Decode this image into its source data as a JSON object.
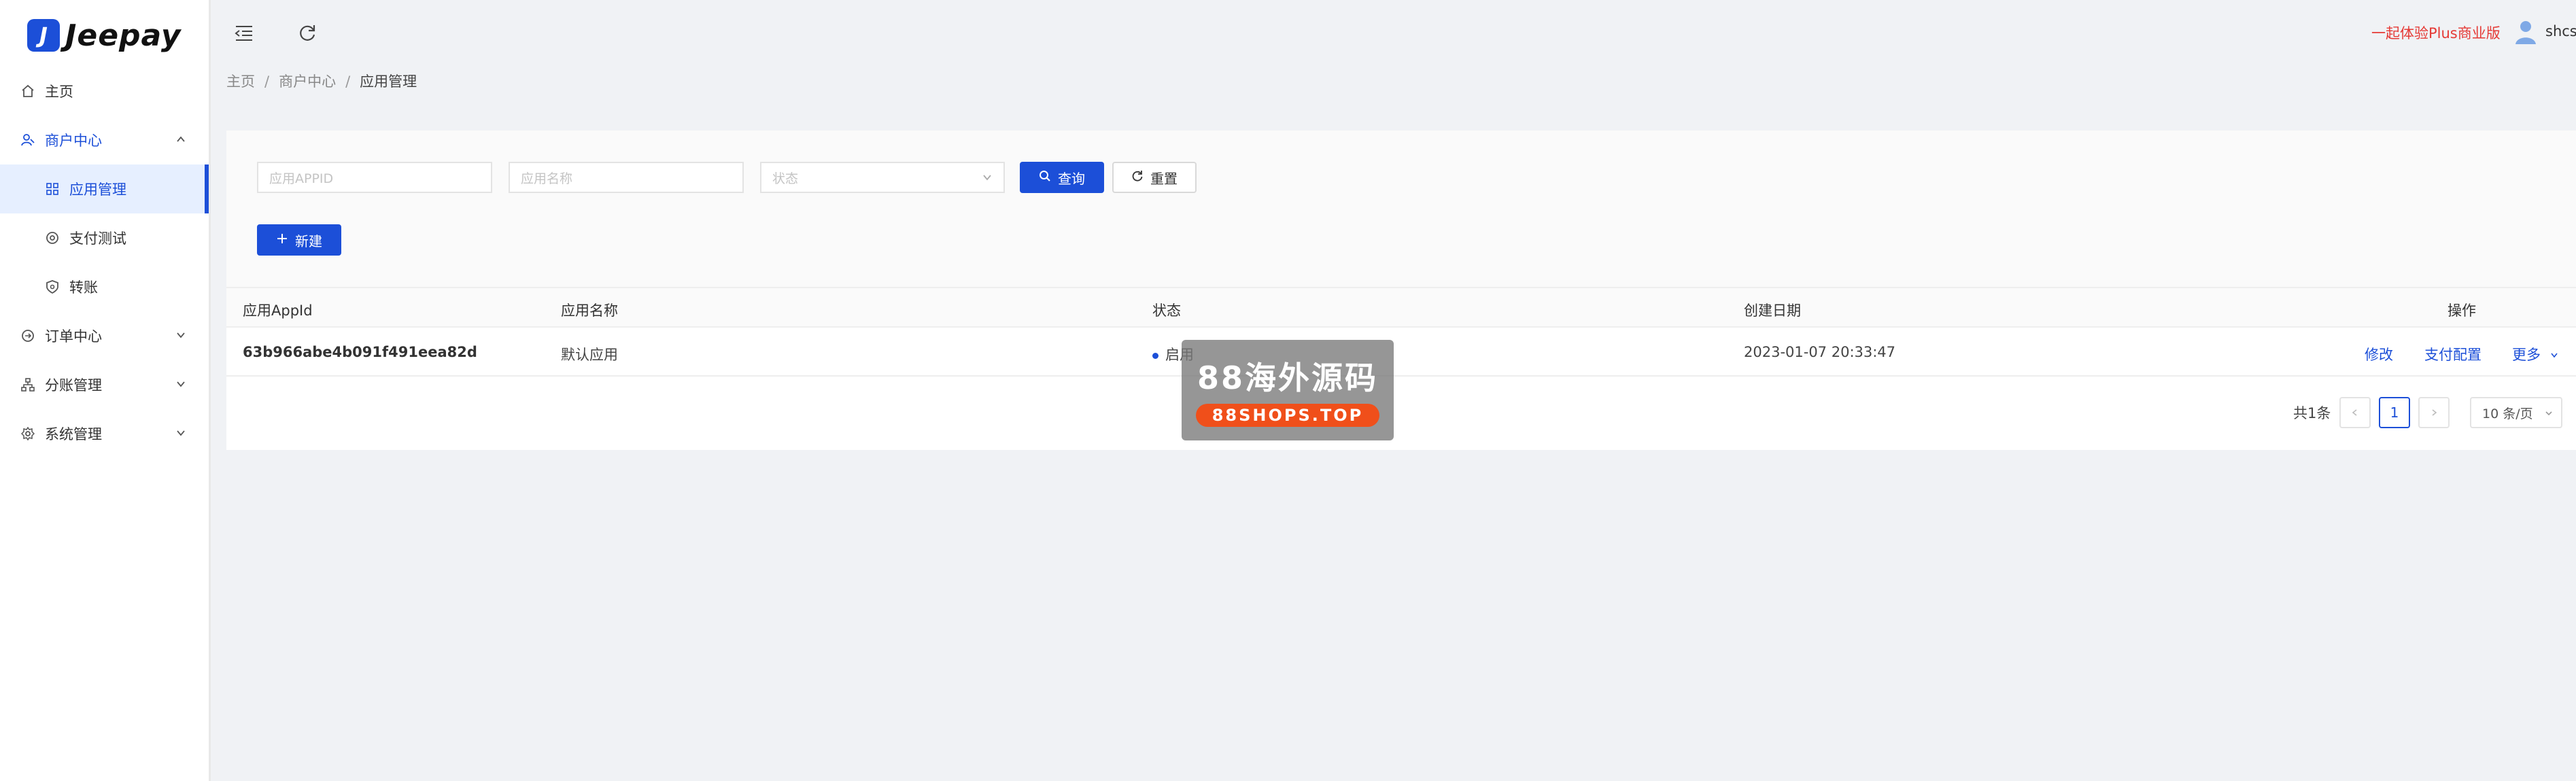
{
  "app": {
    "name": "Jeepay",
    "logo_mark": "J"
  },
  "sidebar": {
    "items": [
      {
        "label": "主页",
        "icon": "home-icon"
      },
      {
        "label": "商户中心",
        "icon": "merchant-icon",
        "expanded": true
      },
      {
        "label": "应用管理",
        "icon": "apps-icon",
        "active": true
      },
      {
        "label": "支付测试",
        "icon": "pay-test-icon"
      },
      {
        "label": "转账",
        "icon": "transfer-icon"
      },
      {
        "label": "订单中心",
        "icon": "order-icon"
      },
      {
        "label": "分账管理",
        "icon": "split-icon"
      },
      {
        "label": "系统管理",
        "icon": "settings-icon"
      }
    ]
  },
  "topbar": {
    "promo": "一起体验Plus商业版",
    "username": "shcs"
  },
  "breadcrumb": [
    "主页",
    "商户中心",
    "应用管理"
  ],
  "filters": {
    "appid_placeholder": "应用APPID",
    "appname_placeholder": "应用名称",
    "status_placeholder": "状态",
    "search_label": "查询",
    "reset_label": "重置",
    "new_label": "新建"
  },
  "table": {
    "columns": [
      "应用AppId",
      "应用名称",
      "状态",
      "创建日期",
      "操作"
    ],
    "rows": [
      {
        "appid": "63b966abe4b091f491eea82d",
        "name": "默认应用",
        "status": "启用",
        "created": "2023-01-07 20:33:47",
        "actions": [
          "修改",
          "支付配置",
          "更多"
        ]
      }
    ]
  },
  "pagination": {
    "total": "共1条",
    "current": "1",
    "page_size": "10 条/页"
  },
  "watermark": {
    "title": "88海外源码",
    "subtitle": "88SHOPS.TOP"
  },
  "colors": {
    "primary": "#1c4fd8",
    "promo": "#e53935",
    "watermark_badge": "#f04f1a"
  }
}
